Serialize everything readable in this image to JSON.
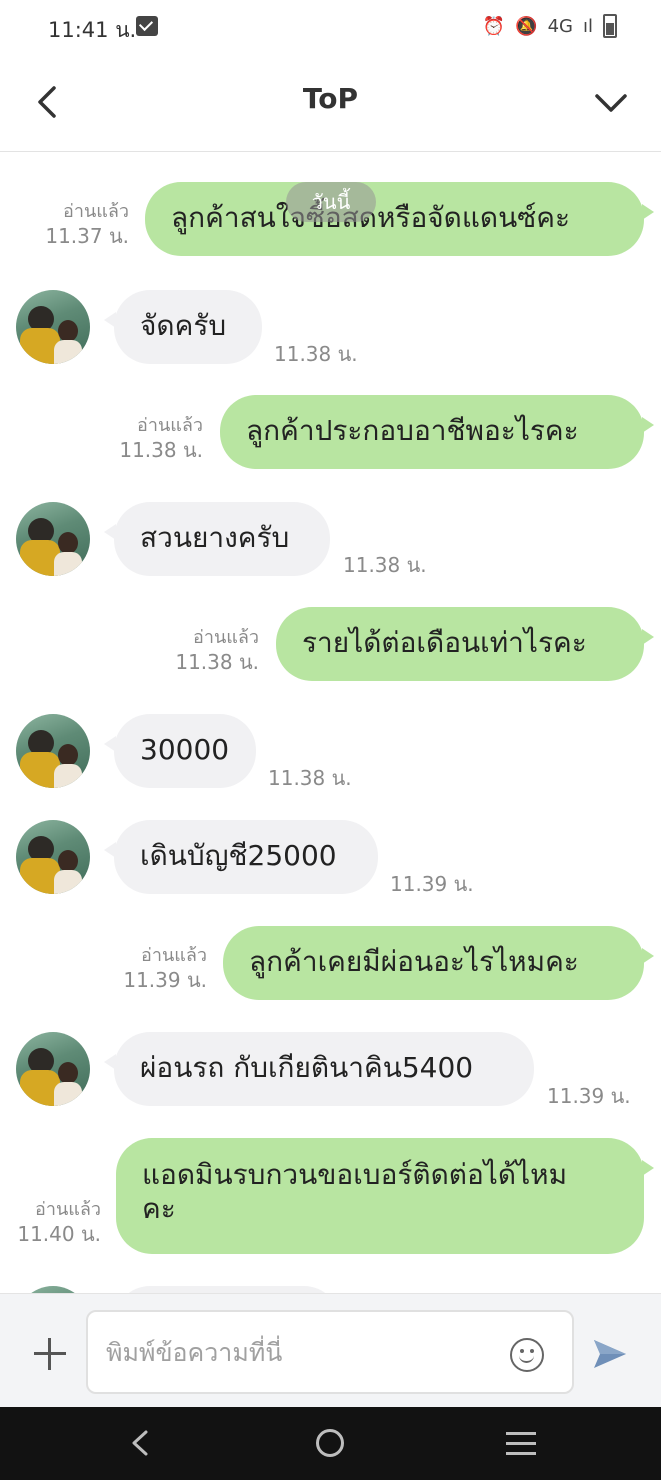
{
  "status_bar": {
    "time": "11:41 น.",
    "network": "4G",
    "signal": "ıl"
  },
  "header": {
    "title": "ToP"
  },
  "date_pill": "วันนี้",
  "messages": [
    {
      "direction": "out",
      "text": "ลูกค้าสนใจซื้อสดหรือจัดแดนซ์คะ",
      "read": "อ่านแล้ว",
      "time": "11.37 น."
    },
    {
      "direction": "in",
      "text": "จัดครับ",
      "time": "11.38 น."
    },
    {
      "direction": "out",
      "text": "ลูกค้าประกอบอาชีพอะไรคะ",
      "read": "อ่านแล้ว",
      "time": "11.38 น."
    },
    {
      "direction": "in",
      "text": "สวนยางครับ",
      "time": "11.38 น."
    },
    {
      "direction": "out",
      "text": "รายได้ต่อเดือนเท่าไรคะ",
      "read": "อ่านแล้ว",
      "time": "11.38 น."
    },
    {
      "direction": "in",
      "text": "30000",
      "time": "11.38 น."
    },
    {
      "direction": "in",
      "text": "เดินบัญชี25000",
      "time": "11.39 น."
    },
    {
      "direction": "out",
      "text": "ลูกค้าเคยมีผ่อนอะไรไหมคะ",
      "read": "อ่านแล้ว",
      "time": "11.39 น."
    },
    {
      "direction": "in",
      "text": "ผ่อนรถ กับเกียตินาคิน5400",
      "time": "11.39 น."
    },
    {
      "direction": "out",
      "text": "แอดมินรบกวนขอเบอร์ติดต่อได้ไหม\nคะ",
      "read": "อ่านแล้ว",
      "time": "11.40 น."
    }
  ],
  "input": {
    "placeholder": "พิมพ์ข้อความที่นี่"
  },
  "icons": {
    "back": "chevron-left-icon",
    "menu": "chevron-down-icon",
    "attach": "plus-icon",
    "emoji": "smiley-icon",
    "send": "send-icon"
  },
  "colors": {
    "outgoing_bubble": "#b8e5a1",
    "incoming_bubble": "#f1f1f3",
    "send_icon": "#6f8fb8"
  }
}
